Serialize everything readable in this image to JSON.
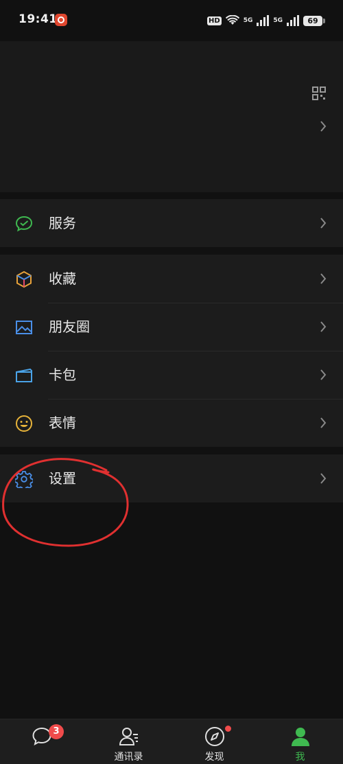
{
  "status_bar": {
    "time": "19:41",
    "hd_label": "HD",
    "network_1": "5G",
    "network_2": "5G",
    "battery": "69"
  },
  "menu": {
    "group1": [
      {
        "label": "服务",
        "icon": "wechat-pay-icon",
        "color": "#3fb950"
      }
    ],
    "group2": [
      {
        "label": "收藏",
        "icon": "favorites-cube-icon",
        "color": "#e8a23a"
      },
      {
        "label": "朋友圈",
        "icon": "moments-image-icon",
        "color": "#4a8fe8"
      },
      {
        "label": "卡包",
        "icon": "card-wallet-icon",
        "color": "#4aa3e8"
      },
      {
        "label": "表情",
        "icon": "smiley-icon",
        "color": "#e8b43a"
      }
    ],
    "group3": [
      {
        "label": "设置",
        "icon": "gear-icon",
        "color": "#4a8fe8"
      }
    ]
  },
  "tabbar": {
    "tabs": [
      {
        "label": "",
        "icon": "chat-bubble-icon",
        "badge": "3"
      },
      {
        "label": "通讯录",
        "icon": "contacts-icon"
      },
      {
        "label": "发现",
        "icon": "compass-icon",
        "dot": true
      },
      {
        "label": "我",
        "icon": "person-icon",
        "active": true
      }
    ]
  },
  "colors": {
    "accent": "#3fb950",
    "badge": "#f04b4b",
    "annotation": "#e03030"
  }
}
